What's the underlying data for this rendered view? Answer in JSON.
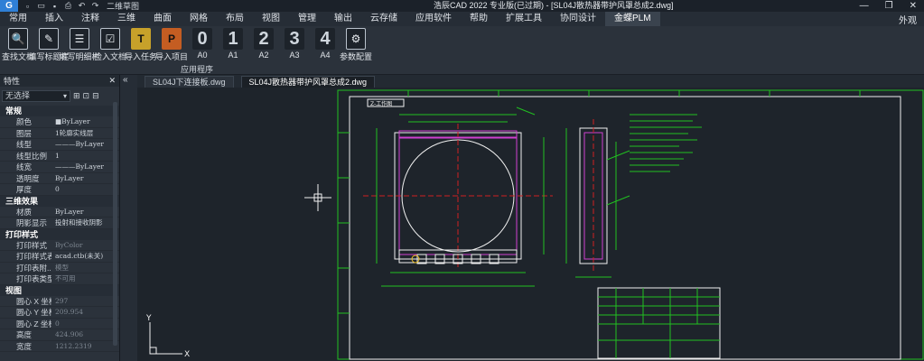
{
  "app": {
    "logo": "G",
    "workspace": "二维草图",
    "title": "浩辰CAD 2022 专业版(已过期) - [SL04J散热器带护风罩总成2.dwg]",
    "appearance": "外观"
  },
  "menu": {
    "items": [
      "常用",
      "插入",
      "注释",
      "三维",
      "曲面",
      "网格",
      "布局",
      "视图",
      "管理",
      "输出",
      "云存储",
      "应用软件",
      "帮助",
      "扩展工具",
      "协同设计",
      "金蝶PLM"
    ]
  },
  "ribbon": {
    "buttons": [
      {
        "label": "查找文档",
        "glyph": "🔍"
      },
      {
        "label": "填写标题栏",
        "glyph": "✎"
      },
      {
        "label": "填写明细栏",
        "glyph": "☰"
      },
      {
        "label": "检入文档",
        "glyph": "☑"
      },
      {
        "label": "导入任务",
        "glyph": "T"
      },
      {
        "label": "导入项目",
        "glyph": "P"
      },
      {
        "label": "A0",
        "glyph": "0"
      },
      {
        "label": "A1",
        "glyph": "1"
      },
      {
        "label": "A2",
        "glyph": "2"
      },
      {
        "label": "A3",
        "glyph": "3"
      },
      {
        "label": "A4",
        "glyph": "4"
      },
      {
        "label": "参数配置",
        "glyph": "⚙"
      }
    ],
    "group_label": "应用程序"
  },
  "properties": {
    "title": "特性",
    "selection": "无选择",
    "sections": [
      {
        "name": "常规",
        "rows": [
          {
            "k": "颜色",
            "v": "■ByLayer"
          },
          {
            "k": "图层",
            "v": "1轮廓实线层"
          },
          {
            "k": "线型",
            "v": "———ByLayer"
          },
          {
            "k": "线型比例",
            "v": "1"
          },
          {
            "k": "线宽",
            "v": "———ByLayer"
          },
          {
            "k": "透明度",
            "v": "ByLayer"
          },
          {
            "k": "厚度",
            "v": "0"
          }
        ]
      },
      {
        "name": "三维效果",
        "rows": [
          {
            "k": "材质",
            "v": "ByLayer"
          },
          {
            "k": "阴影显示",
            "v": "投射和接收阴影"
          }
        ]
      },
      {
        "name": "打印样式",
        "rows": [
          {
            "k": "打印样式",
            "v": "ByColor",
            "dim": true
          },
          {
            "k": "打印样式表",
            "v": "acad.ctb(未关)"
          },
          {
            "k": "打印表附...",
            "v": "模型",
            "dim": true
          },
          {
            "k": "打印表类型",
            "v": "不可用",
            "dim": true
          }
        ]
      },
      {
        "name": "视图",
        "rows": [
          {
            "k": "圆心 X 坐标",
            "v": "297",
            "dim": true
          },
          {
            "k": "圆心 Y 坐标",
            "v": "209.954",
            "dim": true
          },
          {
            "k": "圆心 Z 坐标",
            "v": "0",
            "dim": true
          },
          {
            "k": "高度",
            "v": "424.906",
            "dim": true
          },
          {
            "k": "宽度",
            "v": "1212.2319",
            "dim": true
          }
        ]
      }
    ]
  },
  "doc_tabs": [
    "SL04J下连接板.dwg",
    "SL04J散热器带护风罩总成2.dwg"
  ],
  "drawing": {
    "frame_label": "Z-工作图",
    "axis_y": "Y",
    "axis_x": "X"
  }
}
